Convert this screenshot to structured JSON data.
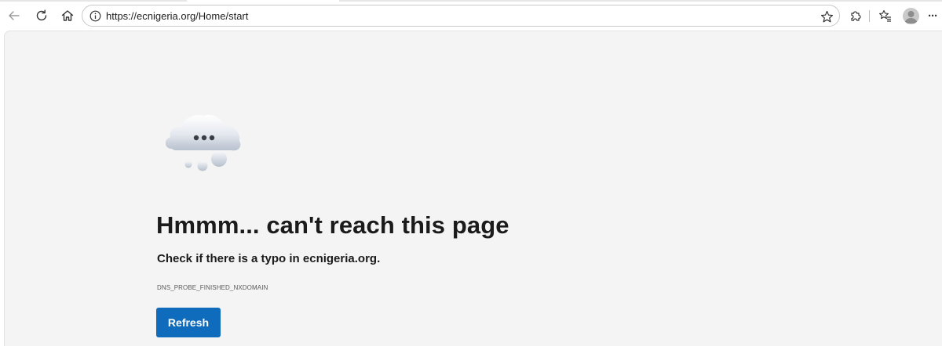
{
  "browser": {
    "url": "https://ecnigeria.org/Home/start",
    "icons": {
      "back": "back-arrow-icon",
      "refresh": "refresh-icon",
      "home": "home-icon",
      "site_info": "info-icon",
      "favorite": "star-icon",
      "extensions": "puzzle-icon",
      "favorites_list": "favorites-icon",
      "profile": "avatar",
      "more": "more-icon"
    },
    "more_label": "···"
  },
  "error_page": {
    "heading": "Hmmm... can't reach this page",
    "message": "Check if there is a typo in ecnigeria.org.",
    "error_code": "DNS_PROBE_FINISHED_NXDOMAIN",
    "refresh_label": "Refresh"
  },
  "colors": {
    "accent": "#0f6cbd",
    "page_bg": "#f4f4f4",
    "text": "#1b1b1b"
  }
}
